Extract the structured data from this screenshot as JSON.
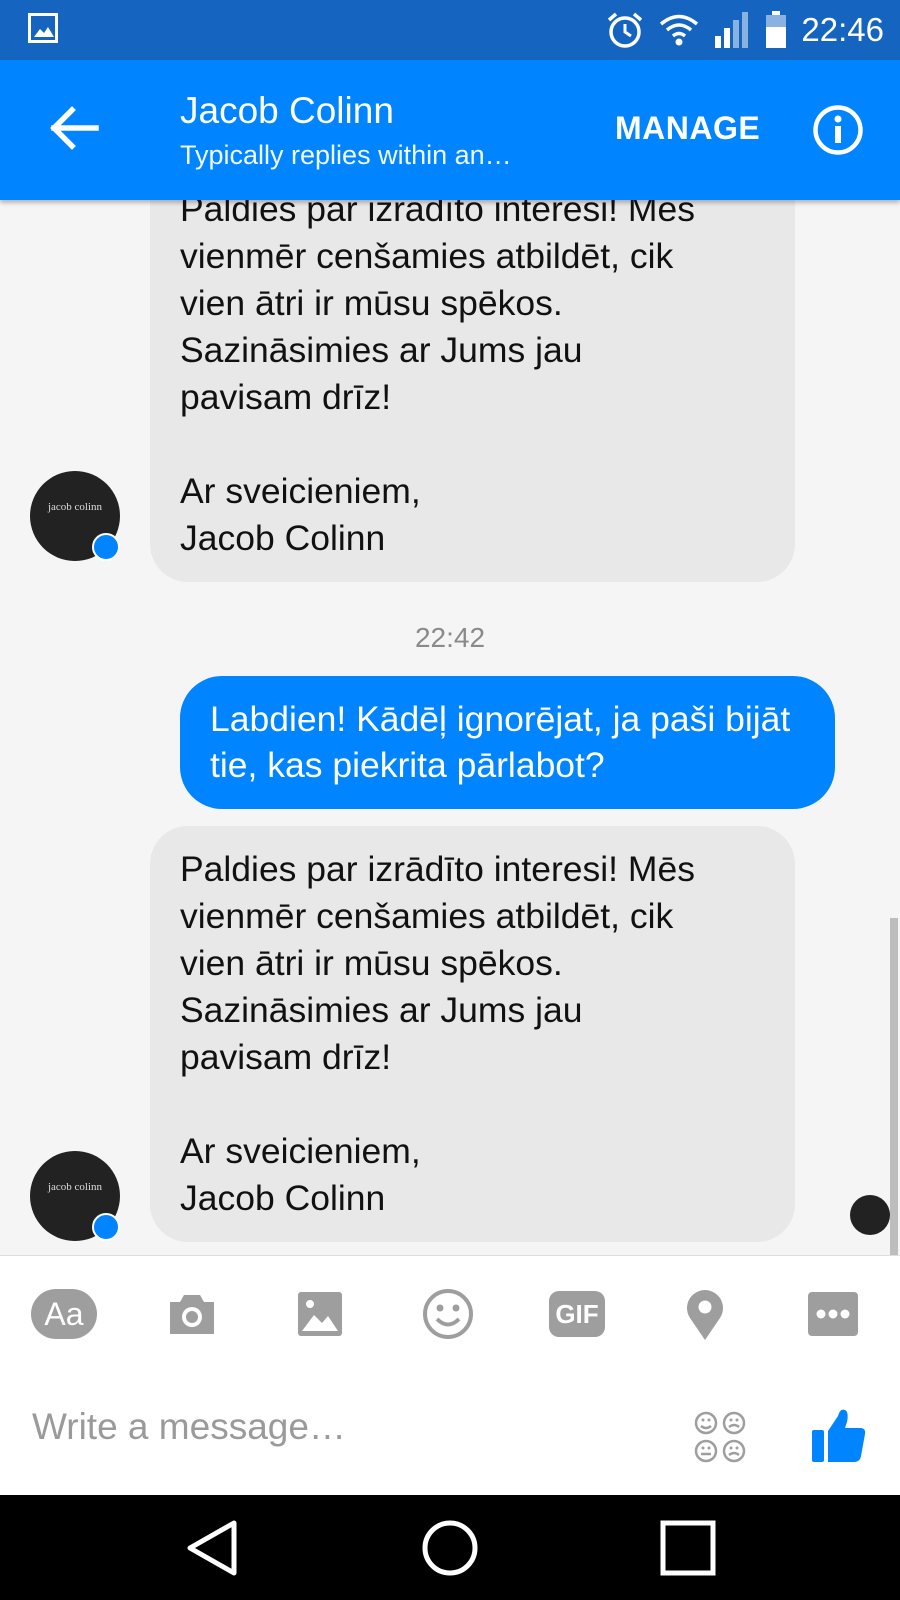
{
  "status_bar": {
    "time": "22:46"
  },
  "header": {
    "title": "Jacob Colinn",
    "subtitle": "Typically replies within an…",
    "manage_label": "MANAGE"
  },
  "messages": {
    "first_reply": "Paldies par izrādīto interesi! Mēs\nvienmēr cenšamies atbildēt, cik\nvien ātri ir mūsu spēkos.\nSazināsimies ar Jums jau\npavisam drīz!\n\nAr sveicieniem,\nJacob Colinn",
    "timestamp": "22:42",
    "user_message": "Labdien! Kādēļ ignorējat, ja paši bijāt tie, kas piekrita pārlabot?",
    "second_reply": "Paldies par izrādīto interesi! Mēs\nvienmēr cenšamies atbildēt, cik\nvien ātri ir mūsu spēkos.\nSazināsimies ar Jums jau\npavisam drīz!\n\nAr sveicieniem,\nJacob Colinn",
    "avatar_logo": "jacob colinn"
  },
  "composer": {
    "text_tool_label": "Aa",
    "gif_label": "GIF",
    "placeholder": "Write a message…"
  },
  "colors": {
    "brand": "#0084ff",
    "status_bar": "#1565c0",
    "incoming_bubble": "#e8e8e8"
  },
  "icons": [
    "photo-icon",
    "alarm-icon",
    "wifi-icon",
    "signal-icon",
    "battery-icon",
    "back-arrow-icon",
    "info-icon",
    "camera-icon",
    "image-icon",
    "emoji-icon",
    "location-icon",
    "more-icon",
    "stickers-icon",
    "thumbs-up-icon",
    "nav-back-icon",
    "nav-home-icon",
    "nav-recents-icon"
  ]
}
